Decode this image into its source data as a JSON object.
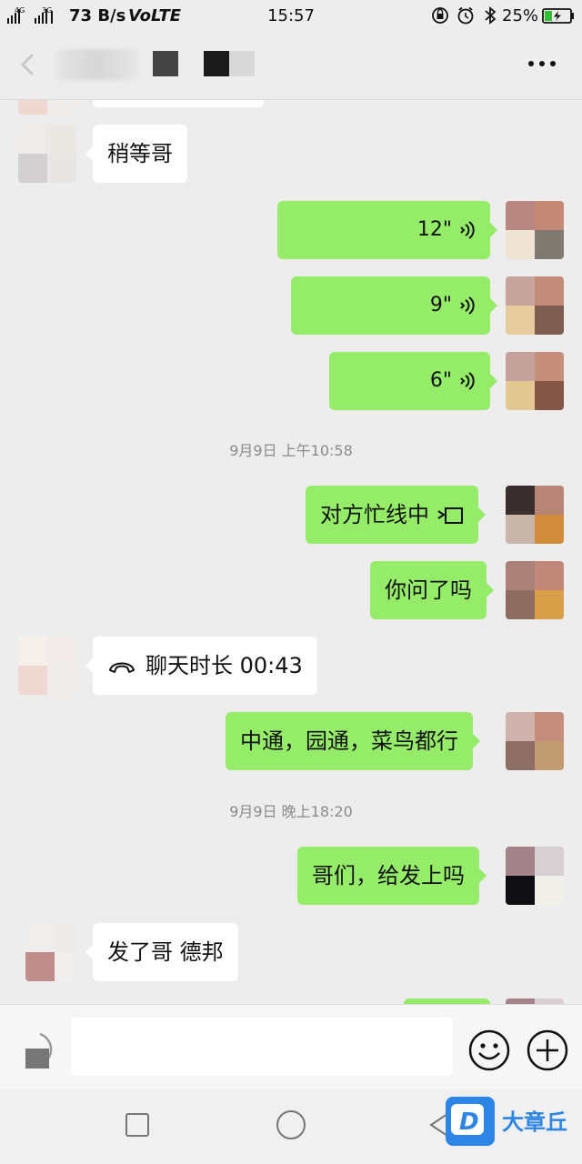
{
  "status_bar": {
    "network_speed": "73 B/s",
    "volte": "VoLTE",
    "time": "15:57",
    "battery_percent": "25%",
    "signal_labels": [
      "4G",
      "3G"
    ]
  },
  "title_bar": {
    "more_label": "•••"
  },
  "messages": [
    {
      "side": "left",
      "text": "稍等哥"
    },
    {
      "side": "right",
      "type": "voice",
      "duration": "12\""
    },
    {
      "side": "right",
      "type": "voice",
      "duration": "9\""
    },
    {
      "side": "right",
      "type": "voice",
      "duration": "6\""
    },
    {
      "type": "timestamp",
      "text": "9月9日 上午10:58"
    },
    {
      "side": "right",
      "text": "对方忙线中",
      "icon": "video-call-icon"
    },
    {
      "side": "right",
      "text": "你问了吗"
    },
    {
      "side": "left",
      "text": "聊天时长 00:43",
      "icon": "phone-hangup-icon"
    },
    {
      "side": "right",
      "text": "中通，园通，菜鸟都行"
    },
    {
      "type": "timestamp",
      "text": "9月9日 晚上18:20"
    },
    {
      "side": "right",
      "text": "哥们，给发上吗"
    },
    {
      "side": "left",
      "text": "发了哥   德邦"
    }
  ],
  "input_bar": {
    "placeholder": ""
  },
  "watermark": {
    "text": "大章丘",
    "logo_letter": "D"
  },
  "colors": {
    "background": "#ededed",
    "sent_bubble": "#95ec69",
    "received_bubble": "#ffffff",
    "timestamp_text": "#8a8a8a",
    "watermark_blue": "#2d86e6"
  }
}
